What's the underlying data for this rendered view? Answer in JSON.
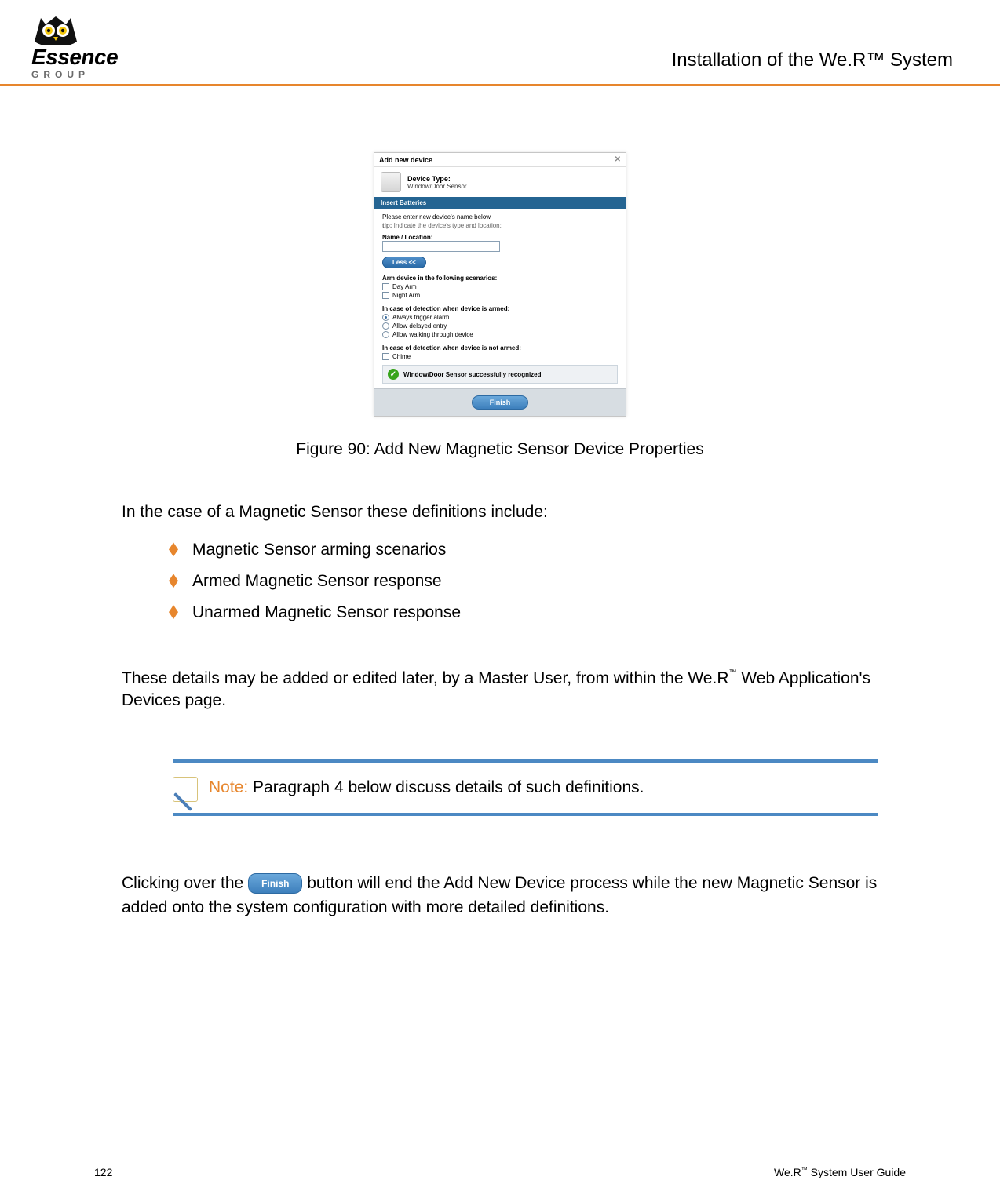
{
  "header": {
    "logo_text": "Essence",
    "logo_sub": "GROUP",
    "title": "Installation of the We.R™ System"
  },
  "dialog": {
    "title": "Add new device",
    "close_glyph": "✕",
    "device_type_label": "Device Type:",
    "device_type_value": "Window/Door Sensor",
    "section_insert_batteries": "Insert Batteries",
    "enter_name": "Please enter new device's name below",
    "tip_label": "tip:",
    "tip_text": "Indicate the device's type and location:",
    "name_location_label": "Name / Location:",
    "name_location_value": "",
    "less_button": "Less <<",
    "arm_heading": "Arm device in the following scenarios:",
    "chk_day_arm": "Day Arm",
    "chk_night_arm": "Night Arm",
    "armed_heading": "In case of detection when device is armed:",
    "rad_trigger": "Always trigger alarm",
    "rad_delayed": "Allow delayed entry",
    "rad_walking": "Allow walking through device",
    "notarmed_heading": "In case of detection when device is not armed:",
    "chk_chime": "Chime",
    "success": "Window/Door Sensor successfully recognized",
    "finish_button": "Finish"
  },
  "figure_caption": "Figure 90: Add New Magnetic Sensor Device Properties",
  "intro_para": "In the case of a Magnetic Sensor these definitions include:",
  "bullets": [
    "Magnetic Sensor arming scenarios",
    "Armed Magnetic Sensor response",
    "Unarmed Magnetic Sensor response"
  ],
  "details_para_a": "These details may be added or edited later, by a Master User, from within the We.R",
  "details_para_b": " Web Application's Devices page.",
  "note_label": "Note:",
  "note_text": " Paragraph 4 below discuss details of such definitions.",
  "click_para_a": "Clicking over the ",
  "click_para_b": " button will end the Add New Device process while the new Magnetic Sensor is added onto the system configuration with more detailed definitions.",
  "inline_finish_label": "Finish",
  "footer": {
    "page_number": "122",
    "guide_a": "We.R",
    "guide_b": " System User Guide"
  }
}
